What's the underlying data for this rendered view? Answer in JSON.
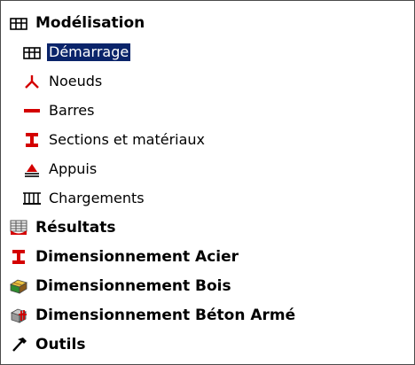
{
  "tree": {
    "items": [
      {
        "label": "Modélisation",
        "level": 0,
        "icon": "frame-structure-icon"
      },
      {
        "label": "Démarrage",
        "level": 1,
        "icon": "frame-structure-icon",
        "selected": true
      },
      {
        "label": "Noeuds",
        "level": 1,
        "icon": "node-icon"
      },
      {
        "label": "Barres",
        "level": 1,
        "icon": "bar-icon"
      },
      {
        "label": "Sections et matériaux",
        "level": 1,
        "icon": "i-beam-section-icon"
      },
      {
        "label": "Appuis",
        "level": 1,
        "icon": "support-icon"
      },
      {
        "label": "Chargements",
        "level": 1,
        "icon": "loads-icon"
      },
      {
        "label": "Résultats",
        "level": 0,
        "icon": "results-table-icon"
      },
      {
        "label": "Dimensionnement Acier",
        "level": 0,
        "icon": "steel-i-beam-icon"
      },
      {
        "label": "Dimensionnement Bois",
        "level": 0,
        "icon": "wood-beam-icon"
      },
      {
        "label": "Dimensionnement Béton Armé",
        "level": 0,
        "icon": "concrete-block-icon"
      },
      {
        "label": "Outils",
        "level": 0,
        "icon": "tools-icon"
      }
    ]
  },
  "colors": {
    "selection_bg": "#0a246a",
    "selection_text": "#ffffff",
    "icon_red": "#d40000"
  }
}
